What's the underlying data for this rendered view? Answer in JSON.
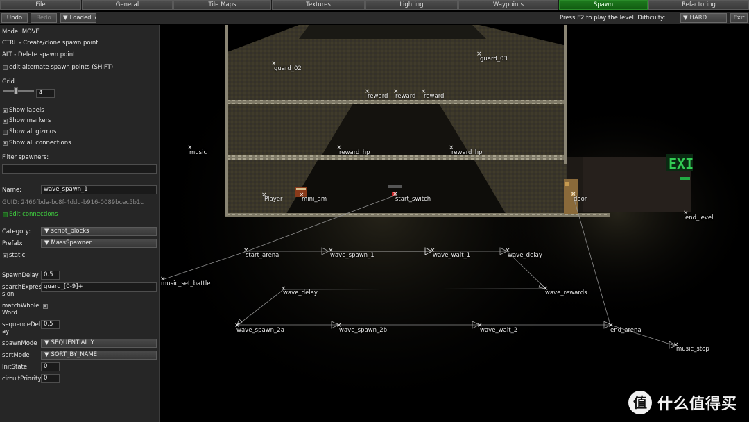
{
  "tabs": [
    "File",
    "General",
    "Tile Maps",
    "Textures",
    "Lighting",
    "Waypoints",
    "Spawn",
    "Refactoring"
  ],
  "active_tab": "Spawn",
  "toolbar": {
    "undo": "Undo",
    "redo": "Redo",
    "loaded": "Loaded le",
    "hint": "Press F2 to play the level. Difficulty:",
    "difficulty": "HARD",
    "exit": "Exit"
  },
  "panel": {
    "mode": "Mode: MOVE",
    "ctrl_hint": "CTRL - Create/clone spawn point",
    "alt_hint": "ALT - Delete spawn point",
    "edit_alternate": "edit alternate spawn points (SHIFT)",
    "grid_label": "Grid",
    "grid_value": "4",
    "show_labels": "Show labels",
    "show_markers": "Show markers",
    "show_gizmos": "Show all gizmos",
    "show_connections": "Show all connections",
    "filter_label": "Filter spawners:",
    "filter_value": "",
    "name_label": "Name:",
    "name_value": "wave_spawn_1",
    "guid": "GUID: 2466fbda-bc8f-4ddd-b916-0089bcec5b1c",
    "edit_connections": "Edit connections",
    "category_label": "Category:",
    "category_value": "script_blocks",
    "prefab_label": "Prefab:",
    "prefab_value": "MassSpawner",
    "static_label": "static",
    "spawn_delay_label": "SpawnDelay",
    "spawn_delay_value": "0.5",
    "search_label_1": "searchExpres",
    "search_label_2": "sion",
    "search_value": "guard_[0-9]+",
    "match_label_1": "matchWhole",
    "match_label_2": "Word",
    "seq_label_1": "sequenceDel",
    "seq_label_2": "ay",
    "seq_value": "0.5",
    "spawn_mode_label": "spawnMode",
    "spawn_mode_value": "SEQUENTIALLY",
    "sort_mode_label": "sortMode",
    "sort_mode_value": "SORT_BY_NAME",
    "init_state_label": "InitState",
    "init_state_value": "0",
    "circuit_label": "circuitPriority",
    "circuit_value": "0"
  },
  "viewport": {
    "labels": {
      "guard_02": "guard_02",
      "guard_03": "guard_03",
      "reward1": "reward",
      "reward2": "reward",
      "reward3": "reward",
      "music": "music",
      "reward_hp1": "reward_hp",
      "reward_hp2": "reward_hp",
      "player": "Player",
      "mini_am": "mini_am",
      "start_switch": "start_switch",
      "door": "door",
      "end_level": "end_level",
      "start_arena": "start_arena",
      "wave_spawn_1": "wave_spawn_1",
      "wave_wait_1": "wave_wait_1",
      "wave_delay_1": "wave_delay",
      "music_set_battle": "music_set_battle",
      "wave_delay_2": "wave_delay",
      "wave_rewards": "wave_rewards",
      "wave_spawn_2a": "wave_spawn_2a",
      "wave_spawn_2b": "wave_spawn_2b",
      "wave_wait_2": "wave_wait_2",
      "end_arena": "end_arena",
      "music_stop": "music_stop"
    },
    "exit_sign": "EXI"
  },
  "watermark": {
    "logo": "值",
    "text": "什么值得买"
  },
  "colors": {
    "tab_active": "#1e7a1e",
    "panel_bg": "#262626",
    "exit_green": "#33cc55"
  }
}
